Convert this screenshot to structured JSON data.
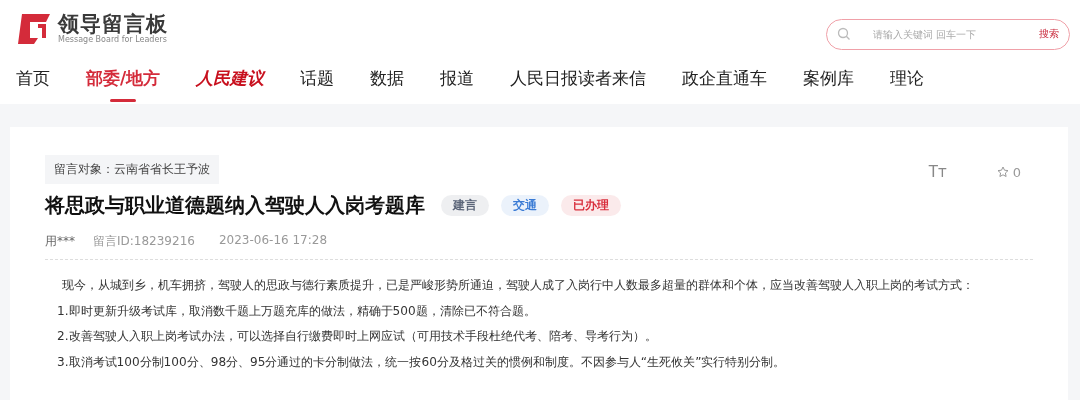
{
  "logo": {
    "title": "领导留言板",
    "subtitle": "Message Board for Leaders"
  },
  "search": {
    "placeholder": "请输入关键词 回车一下",
    "button": "搜索"
  },
  "nav": [
    {
      "label": "首页",
      "kind": "text",
      "selected": false
    },
    {
      "label": "部委/地方",
      "kind": "text",
      "selected": true
    },
    {
      "label": "人民建议",
      "kind": "brand",
      "selected": false
    },
    {
      "label": "话题",
      "kind": "text",
      "selected": false
    },
    {
      "label": "数据",
      "kind": "text",
      "selected": false
    },
    {
      "label": "报道",
      "kind": "text",
      "selected": false
    },
    {
      "label": "人民日报读者来信",
      "kind": "text",
      "selected": false
    },
    {
      "label": "政企直通车",
      "kind": "text",
      "selected": false
    },
    {
      "label": "案例库",
      "kind": "text",
      "selected": false
    },
    {
      "label": "理论",
      "kind": "text",
      "selected": false
    }
  ],
  "message": {
    "recipient": "留言对象：云南省省长王予波",
    "title": "将思政与职业道德题纳入驾驶人入岗考题库",
    "tags": [
      {
        "label": "建言",
        "color": "#5a6478"
      },
      {
        "label": "交通",
        "color": "#3a7bd5"
      },
      {
        "label": "已办理",
        "color": "#d9303e"
      }
    ],
    "font_button": "Tт",
    "favorites": "0",
    "author": "用***",
    "id": "留言ID:18239216",
    "date": "2023-06-16 17:28",
    "paragraphs": [
      "现今，从城到乡，机车拥挤，驾驶人的思政与德行素质提升，已是严峻形势所通迫，驾驶人成了入岗行中人数最多超量的群体和个体，应当改善驾驶人入职上岗的考试方式：",
      "1.即时更新升级考试库，取消数千题上万题充库的做法，精确于500题，清除已不符合题。",
      "2.改善驾驶人入职上岗考试办法，可以选择自行缴费即时上网应试（可用技术手段杜绝代考、陪考、导考行为）。",
      "3.取消考试100分制100分、98分、95分通过的卡分制做法，统一按60分及格过关的惯例和制度。不因参与人“生死攸关”实行特别分制。"
    ]
  }
}
